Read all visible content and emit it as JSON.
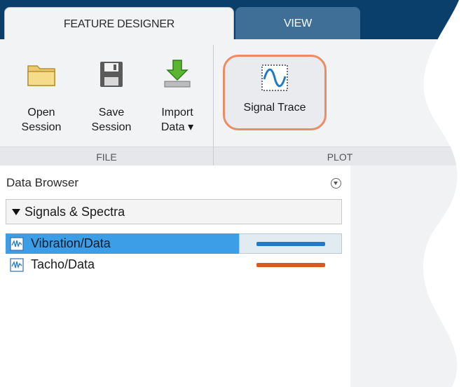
{
  "tabs": [
    {
      "label": "FEATURE DESIGNER",
      "active": true
    },
    {
      "label": "VIEW",
      "active": false
    }
  ],
  "ribbon": {
    "file": {
      "label": "FILE",
      "buttons": [
        {
          "line1": "Open",
          "line2": "Session",
          "icon": "folder-icon"
        },
        {
          "line1": "Save",
          "line2": "Session",
          "icon": "save-disk-icon"
        },
        {
          "line1": "Import",
          "line2": "Data ▾",
          "icon": "import-arrow-icon"
        }
      ]
    },
    "plot": {
      "label": "PLOT",
      "button": {
        "label": "Signal Trace",
        "icon": "signal-wave-icon"
      }
    }
  },
  "data_browser": {
    "title": "Data Browser",
    "group_label": "Signals & Spectra",
    "items": [
      {
        "name": "Vibration/Data",
        "color": "#1f7bc6",
        "selected": true
      },
      {
        "name": "Tacho/Data",
        "color": "#d95a1e",
        "selected": false
      }
    ]
  },
  "colors": {
    "tab_strip": "#0b3f6b",
    "selection": "#3b9ee6",
    "highlight_ring": "#ec8c67"
  }
}
